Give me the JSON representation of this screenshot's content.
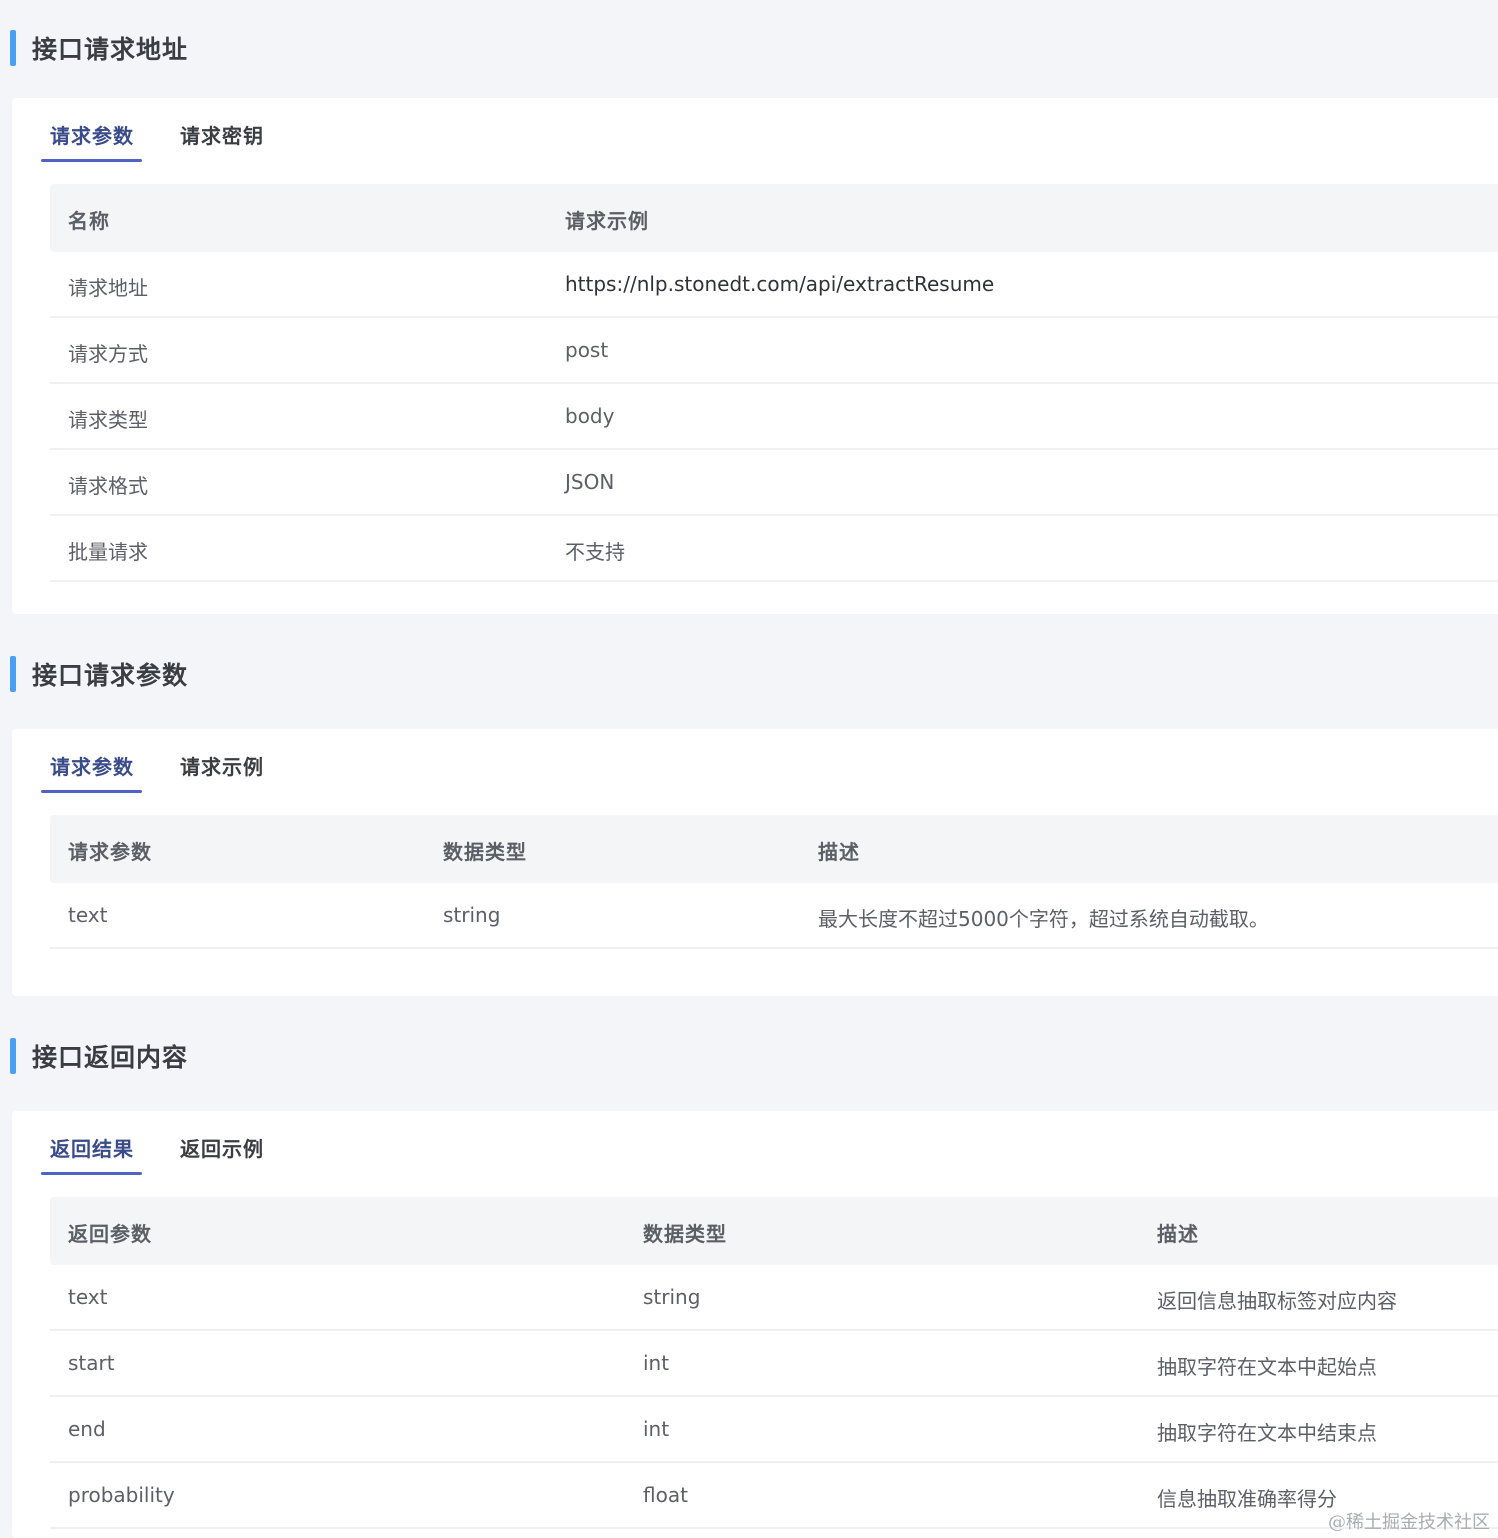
{
  "sections": [
    {
      "title": "接口请求地址",
      "tabs": [
        "请求参数",
        "请求密钥"
      ],
      "table": {
        "headers": [
          "名称",
          "请求示例"
        ],
        "rows": [
          [
            "请求地址",
            "https://nlp.stonedt.com/api/extractResume"
          ],
          [
            "请求方式",
            "post"
          ],
          [
            "请求类型",
            "body"
          ],
          [
            "请求格式",
            "JSON"
          ],
          [
            "批量请求",
            "不支持"
          ]
        ]
      }
    },
    {
      "title": "接口请求参数",
      "tabs": [
        "请求参数",
        "请求示例"
      ],
      "table": {
        "headers": [
          "请求参数",
          "数据类型",
          "描述"
        ],
        "rows": [
          [
            "text",
            "string",
            "最大长度不超过5000个字符，超过系统自动截取。"
          ]
        ]
      }
    },
    {
      "title": "接口返回内容",
      "tabs": [
        "返回结果",
        "返回示例"
      ],
      "table": {
        "headers": [
          "返回参数",
          "数据类型",
          "描述"
        ],
        "rows": [
          [
            "text",
            "string",
            "返回信息抽取标签对应内容"
          ],
          [
            "start",
            "int",
            "抽取字符在文本中起始点"
          ],
          [
            "end",
            "int",
            "抽取字符在文本中结束点"
          ],
          [
            "probability",
            "float",
            "信息抽取准确率得分"
          ]
        ]
      }
    }
  ],
  "watermark": "@稀土掘金技术社区",
  "colors": {
    "accent_bar": "#4a9ff5",
    "tab_underline": "#4f63c2",
    "page_bg": "#f3f5f8",
    "header_bg": "#f4f5f7"
  }
}
